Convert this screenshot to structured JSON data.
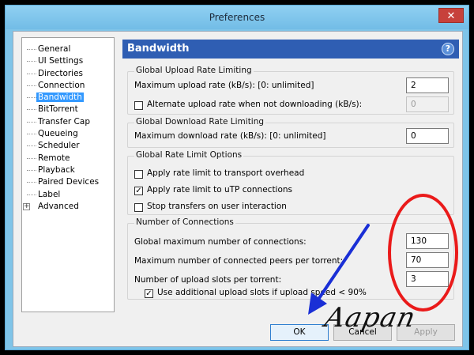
{
  "window": {
    "title": "Preferences",
    "close_glyph": "✕"
  },
  "tree": {
    "items": [
      {
        "label": "General"
      },
      {
        "label": "UI Settings"
      },
      {
        "label": "Directories"
      },
      {
        "label": "Connection"
      },
      {
        "label": "Bandwidth",
        "selected": true
      },
      {
        "label": "BitTorrent"
      },
      {
        "label": "Transfer Cap"
      },
      {
        "label": "Queueing"
      },
      {
        "label": "Scheduler"
      },
      {
        "label": "Remote"
      },
      {
        "label": "Playback"
      },
      {
        "label": "Paired Devices"
      },
      {
        "label": "Label"
      },
      {
        "label": "Advanced",
        "expandable": true
      }
    ],
    "expander_glyph": "+"
  },
  "header": {
    "title": "Bandwidth",
    "help_glyph": "?"
  },
  "upload": {
    "group_title": "Global Upload Rate Limiting",
    "max_label": "Maximum upload rate (kB/s): [0: unlimited]",
    "max_value": "2",
    "alt_label": "Alternate upload rate when not downloading (kB/s):",
    "alt_checked": false,
    "alt_value": "0"
  },
  "download": {
    "group_title": "Global Download Rate Limiting",
    "max_label": "Maximum download rate (kB/s): [0: unlimited]",
    "max_value": "0"
  },
  "rate_options": {
    "group_title": "Global Rate Limit Options",
    "transport_label": "Apply rate limit to transport overhead",
    "transport_checked": false,
    "utp_label": "Apply rate limit to uTP connections",
    "utp_checked": true,
    "stop_label": "Stop transfers on user interaction",
    "stop_checked": false
  },
  "connections": {
    "group_title": "Number of Connections",
    "global_label": "Global maximum number of connections:",
    "global_value": "130",
    "peers_label": "Maximum number of connected peers per torrent:",
    "peers_value": "70",
    "slots_label": "Number of upload slots per torrent:",
    "slots_value": "3",
    "additional_label": "Use additional upload slots if upload speed < 90%",
    "additional_checked": true
  },
  "buttons": {
    "ok": "OK",
    "cancel": "Cancel",
    "apply": "Apply"
  },
  "annotation": {
    "signature": "Aapan"
  },
  "check_glyph": "✓",
  "colors": {
    "header_blue": "#2f5eb3",
    "selection_blue": "#3399ff",
    "annotation_red": "#ea1a1a",
    "annotation_arrow": "#1a2fd6"
  }
}
